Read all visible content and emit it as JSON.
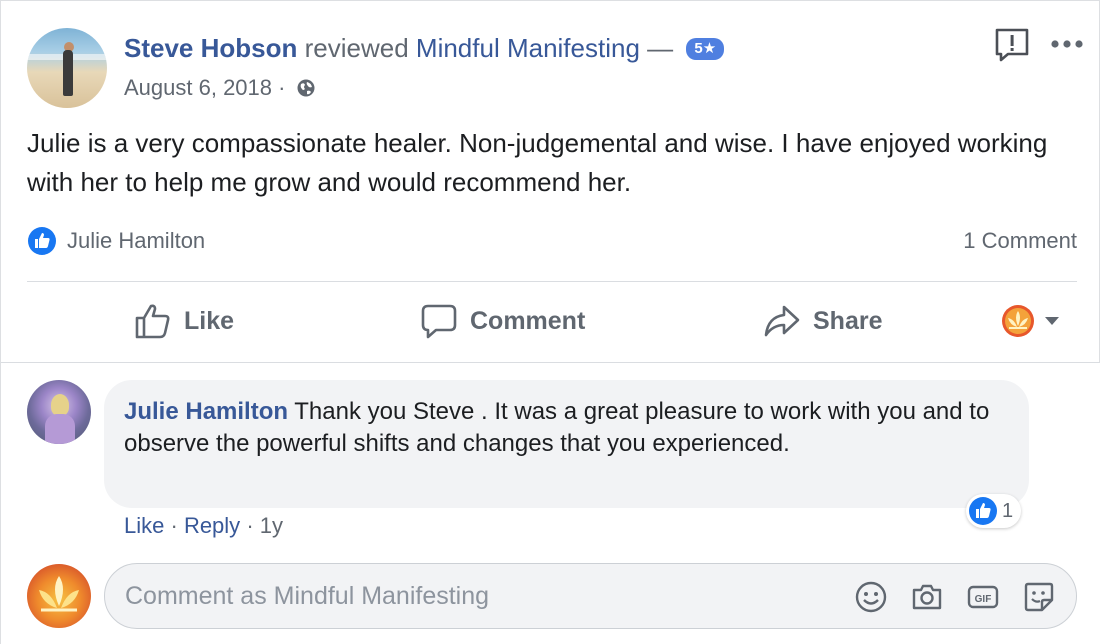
{
  "post": {
    "author": "Steve Hobson",
    "verb": "reviewed",
    "page": "Mindful Manifesting",
    "dash": "—",
    "rating": "5★",
    "date": "August 6, 2018",
    "date_sep": "·",
    "body": "Julie is a very compassionate healer. Non-judgemental and wise. I have enjoyed working with her to help me grow and would recommend her.",
    "reactor": "Julie Hamilton",
    "comment_count": "1 Comment"
  },
  "actions": {
    "like": "Like",
    "comment": "Comment",
    "share": "Share"
  },
  "comment": {
    "author": "Julie Hamilton",
    "text": "Thank you Steve . It was a great pleasure to work with you and to observe the powerful shifts and changes that you experienced.",
    "like_label": "Like",
    "reply_label": "Reply",
    "sep": "·",
    "time": "1y",
    "reaction_count": "1"
  },
  "composer": {
    "placeholder": "Comment as Mindful Manifesting"
  },
  "colors": {
    "link": "#385898",
    "muted": "#606770",
    "like_blue": "#1877f2",
    "badge": "#4f7fe0"
  },
  "icons": [
    "globe-icon",
    "report-icon",
    "more-icon",
    "like-icon",
    "comment-icon",
    "share-icon",
    "page-logo-icon",
    "chevron-down-icon",
    "emoji-icon",
    "camera-icon",
    "gif-icon",
    "sticker-icon"
  ]
}
